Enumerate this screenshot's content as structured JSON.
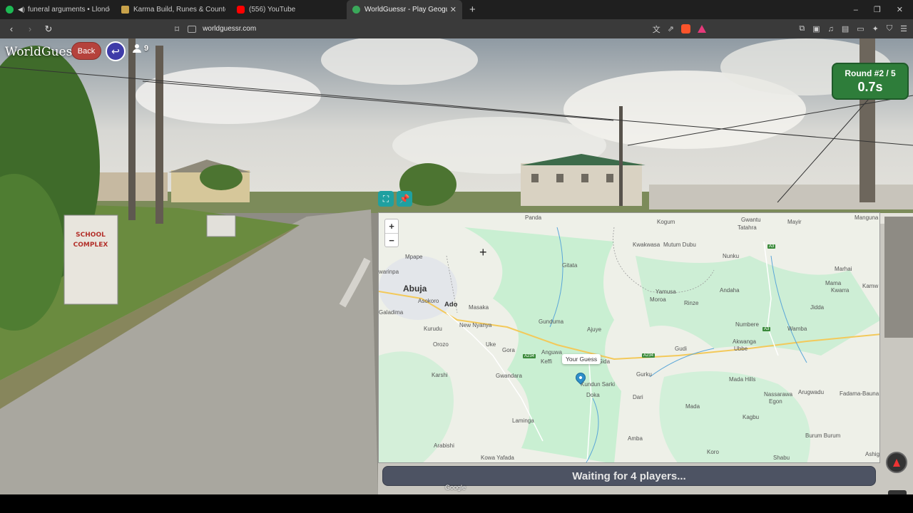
{
  "browser": {
    "tabs": [
      {
        "label": "funeral arguments • Llondon actu",
        "favicon_color": "#1db954",
        "playing": true
      },
      {
        "label": "Karma Build, Runes & Counters Guide",
        "favicon_color": "#c8a24a",
        "playing": false
      },
      {
        "label": "(556) YouTube",
        "favicon_color": "#ff0000",
        "playing": false
      },
      {
        "label": "WorldGuessr - Play Geoguessr free",
        "favicon_color": "#3aa85a",
        "playing": false,
        "active": true
      }
    ],
    "new_tab_icon": "plus-icon",
    "window_controls": [
      "–",
      "❐",
      "✕"
    ],
    "url": "worldguessr.com"
  },
  "game": {
    "brand": "WorldGuessr",
    "back_label": "Back",
    "player_count": "9",
    "round_label": "Round #2 / 5",
    "timer": "0.7s",
    "waiting_text": "Waiting for 4 players...",
    "google_label": "Google"
  },
  "map": {
    "zoom_in": "+",
    "zoom_out": "−",
    "guess_label": "Your Guess",
    "places": [
      {
        "name": "Panda",
        "cls": ""
      },
      {
        "name": "Kogum",
        "cls": ""
      },
      {
        "name": "Gwantu",
        "cls": ""
      },
      {
        "name": "Tatahra",
        "cls": ""
      },
      {
        "name": "Mayir",
        "cls": ""
      },
      {
        "name": "Manguna",
        "cls": ""
      },
      {
        "name": "Mpape",
        "cls": ""
      },
      {
        "name": "Kwakwasa",
        "cls": ""
      },
      {
        "name": "Mutum Dubu",
        "cls": ""
      },
      {
        "name": "Nunku",
        "cls": ""
      },
      {
        "name": "Marhai",
        "cls": ""
      },
      {
        "name": "warinpa",
        "cls": ""
      },
      {
        "name": "Gitata",
        "cls": ""
      },
      {
        "name": "Mama",
        "cls": ""
      },
      {
        "name": "Kwarra",
        "cls": ""
      },
      {
        "name": "Kamw",
        "cls": ""
      },
      {
        "name": "Abuja",
        "cls": "big"
      },
      {
        "name": "Andaha",
        "cls": ""
      },
      {
        "name": "Asokoro",
        "cls": ""
      },
      {
        "name": "Yamusa",
        "cls": ""
      },
      {
        "name": "Moroa",
        "cls": ""
      },
      {
        "name": "Rinze",
        "cls": ""
      },
      {
        "name": "Ado",
        "cls": "med"
      },
      {
        "name": "Masaka",
        "cls": ""
      },
      {
        "name": "Jidda",
        "cls": ""
      },
      {
        "name": "Galadima",
        "cls": ""
      },
      {
        "name": "Gunduma",
        "cls": ""
      },
      {
        "name": "Numbere",
        "cls": ""
      },
      {
        "name": "New Nyanya",
        "cls": ""
      },
      {
        "name": "Kurudu",
        "cls": ""
      },
      {
        "name": "Ajuye",
        "cls": ""
      },
      {
        "name": "Wamba",
        "cls": ""
      },
      {
        "name": "Orozo",
        "cls": ""
      },
      {
        "name": "Uke",
        "cls": ""
      },
      {
        "name": "Akwanga",
        "cls": ""
      },
      {
        "name": "Ubbe",
        "cls": ""
      },
      {
        "name": "Gora",
        "cls": ""
      },
      {
        "name": "Gudi",
        "cls": ""
      },
      {
        "name": "Anguwa",
        "cls": ""
      },
      {
        "name": "Keffi",
        "cls": ""
      },
      {
        "name": "Sida",
        "cls": ""
      },
      {
        "name": "Karshi",
        "cls": ""
      },
      {
        "name": "Gwandara",
        "cls": ""
      },
      {
        "name": "Gurku",
        "cls": ""
      },
      {
        "name": "Mada Hills",
        "cls": ""
      },
      {
        "name": "Kundun Sarki",
        "cls": ""
      },
      {
        "name": "Nassarawa",
        "cls": ""
      },
      {
        "name": "Egon",
        "cls": ""
      },
      {
        "name": "Arugwadu",
        "cls": ""
      },
      {
        "name": "Fadama-Bauna",
        "cls": ""
      },
      {
        "name": "Doka",
        "cls": ""
      },
      {
        "name": "Dari",
        "cls": ""
      },
      {
        "name": "Mada",
        "cls": ""
      },
      {
        "name": "Laminga",
        "cls": ""
      },
      {
        "name": "Kagbu",
        "cls": ""
      },
      {
        "name": "Burum Burum",
        "cls": ""
      },
      {
        "name": "Amba",
        "cls": ""
      },
      {
        "name": "Arabishi",
        "cls": ""
      },
      {
        "name": "Koro",
        "cls": ""
      },
      {
        "name": "Kowa Yafada",
        "cls": ""
      },
      {
        "name": "Shabu",
        "cls": ""
      },
      {
        "name": "Ashige",
        "cls": ""
      }
    ],
    "road_shields": [
      "A3",
      "A3",
      "A234",
      "A234"
    ]
  }
}
